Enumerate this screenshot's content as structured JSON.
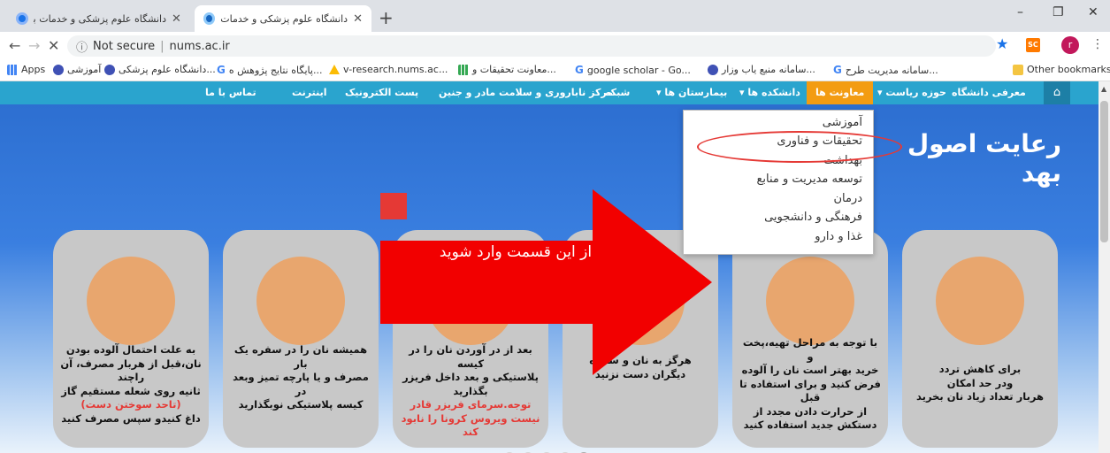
{
  "browser": {
    "tabs": [
      {
        "title": "دانشگاه علوم پزشکی و خدمات بهدا",
        "active": false
      },
      {
        "title": "دانشگاه علوم پزشکی و خدمات بهدا",
        "active": true
      }
    ],
    "new_tab": "+",
    "window_controls": {
      "minimize": "–",
      "restore": "❐",
      "close": "✕"
    },
    "url_security": "Not secure",
    "url": "nums.ac.ir",
    "extension_label": "SC",
    "profile_initial": "r",
    "bookmarks": [
      {
        "label": "Apps",
        "icon": "apps-grid-icon"
      },
      {
        "label": "آموزشی",
        "icon": "site-icon"
      },
      {
        "label": "دانشگاه علوم پزشکی...",
        "icon": "site-icon"
      },
      {
        "label": "پایگاه نتایج پژوهش ه...",
        "icon": "google-icon"
      },
      {
        "label": "v-research.nums.ac...",
        "icon": "drive-icon"
      },
      {
        "label": "معاونت تحقیقات و...",
        "icon": "grid-icon"
      },
      {
        "label": "google scholar - Go...",
        "icon": "google-icon"
      },
      {
        "label": "سامانه منبع یاب وزار...",
        "icon": "site-icon"
      },
      {
        "label": "سامانه مدیریت طرح...",
        "icon": "google-icon"
      },
      {
        "label": "Other bookmarks",
        "icon": "folder-icon"
      }
    ]
  },
  "site": {
    "nav": {
      "home": "⌂",
      "items": [
        {
          "label": "معرفی دانشگاه"
        },
        {
          "label": "حوزه ریاست ▾"
        },
        {
          "label": "معاونت ها"
        },
        {
          "label": "دانشکده ها ▾"
        },
        {
          "label": "بیمارستان ها ▾"
        },
        {
          "label": "شبکه"
        },
        {
          "label": "مرکز ناباروری و سلامت مادر و جنین"
        },
        {
          "label": "پست الکترونیک"
        },
        {
          "label": "اینترنت"
        },
        {
          "label": "تماس با ما"
        }
      ]
    },
    "hero_title": "رعایت اصول بهد",
    "dropdown": {
      "items": [
        "آموزشی",
        "تحقیقات و فناوری",
        "بهداشت",
        "توسعه مدیریت و منابع",
        "درمان",
        "فرهنگی و دانشجویی",
        "غذا و دارو"
      ],
      "highlighted_index": 1
    },
    "annotation_text": "از این قسمت وارد شوید",
    "slider": {
      "prev": "‹",
      "next": "›",
      "active_dot": 4,
      "dot_count": 5,
      "cards": [
        {
          "lines": [
            "به علت احتمال آلوده بودن",
            "نان،قبل از هربار مصرف، آن راچند",
            "ثانیه روی شعله مستقیم گاز"
          ],
          "red": "(تاحد سوختن دست)",
          "tail": "داغ کنیدو سپس مصرف کنید"
        },
        {
          "lines": [
            "همیشه نان را در سفره یک بار",
            "مصرف و یا پارچه تمیز وبعد در",
            "کیسه پلاستیکی نوبگذارید"
          ],
          "red": "",
          "tail": ""
        },
        {
          "lines": [
            "بعد از در آوردن نان را در کیسه",
            "پلاستیکی و بعد داخل فریزر",
            "بگذارید"
          ],
          "red": "توجه.سرمای فریزر قادر نیست ویروس کرونا را نابود کند",
          "tail": ""
        },
        {
          "lines": [
            "هرگز به نان و سفره",
            "دیگران دست نزنید"
          ],
          "red": "",
          "tail": ""
        },
        {
          "lines": [
            "با توجه به مراحل تهیه،پخت و",
            "خرید بهتر است نان را آلوده",
            "فرض کنید و برای استفاده تا قبل",
            "از حرارت دادن مجدد از",
            "دستکش جدید استفاده کنید"
          ],
          "red": "",
          "tail": ""
        },
        {
          "lines": [
            "برای کاهش تردد",
            "ودر حد امکان",
            "هربار تعداد زیاد نان بخرید"
          ],
          "red": "",
          "tail": ""
        }
      ]
    }
  }
}
